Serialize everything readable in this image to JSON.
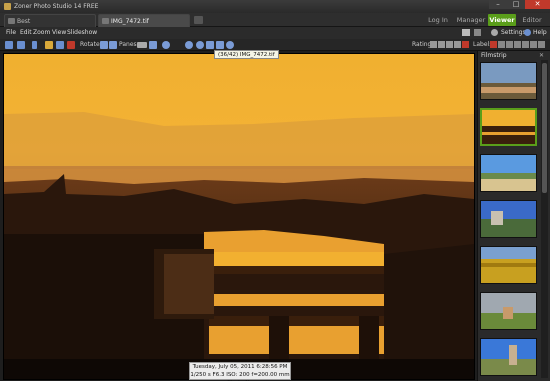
{
  "window": {
    "title": "Zoner Photo Studio 14 FREE",
    "min": "–",
    "max": "□",
    "close": "✕"
  },
  "tabs": [
    {
      "label": "Best"
    },
    {
      "label": "IMG_7472.tif"
    }
  ],
  "modes": {
    "login": "Log In",
    "manager": "Manager",
    "viewer": "Viewer",
    "editor": "Editor"
  },
  "menu": {
    "file": "File",
    "edit": "Edit",
    "zoom": "Zoom",
    "view": "View",
    "slideshow": "Slideshow",
    "settings": "Settings",
    "help": "Help"
  },
  "toolbar": {
    "rotate_label": "Rotate:",
    "panes_label": "Panes:",
    "rating_label": "Rating:",
    "label_label": "Label:",
    "tooltip": "(36/42) IMG_7472.tif"
  },
  "status": {
    "line1": "Tuesday, July 05, 2011 6:28:56 PM",
    "line2": "1/250 s F6.3 ISO: 200 f=200.00 mm Flash: No"
  },
  "filmstrip": {
    "label": "Filmstrip",
    "close": "✕"
  },
  "colors": {
    "accent": "#5a9e1a",
    "close": "#c0392b"
  }
}
